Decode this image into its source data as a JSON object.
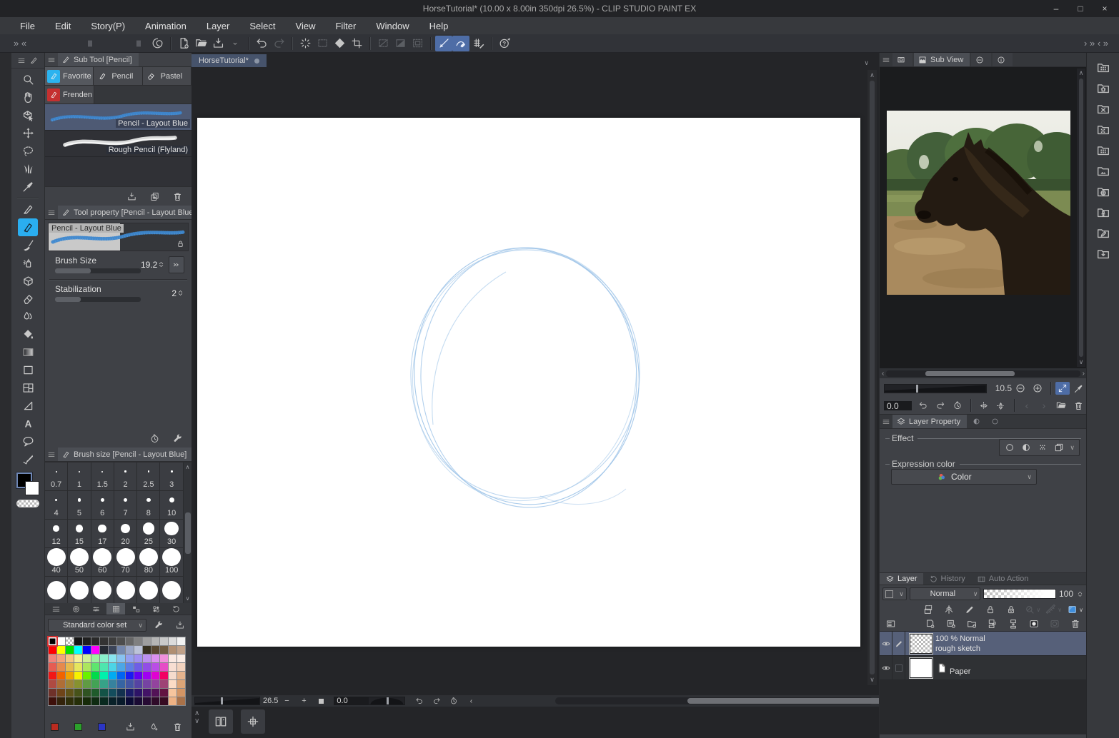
{
  "window": {
    "title": "HorseTutorial* (10.00 x 8.00in 350dpi 26.5%)  - CLIP STUDIO PAINT EX",
    "minimize": "–",
    "maximize": "□",
    "close": "×"
  },
  "menubar": [
    "File",
    "Edit",
    "Story(P)",
    "Animation",
    "Layer",
    "Select",
    "View",
    "Filter",
    "Window",
    "Help"
  ],
  "command_bar": {
    "left_collapse": "» «",
    "right_collapse": "› » ‹ »",
    "groups": [
      [
        {
          "icon": "clip-studio-logo",
          "name": "clip-studio-home"
        }
      ],
      [
        {
          "icon": "new-document",
          "name": "new-document"
        },
        {
          "icon": "open-file",
          "name": "open-file"
        },
        {
          "icon": "save-file",
          "name": "save-file"
        },
        {
          "icon": "chevron-down",
          "name": "save-options",
          "small": true
        }
      ],
      [
        {
          "icon": "undo",
          "name": "undo"
        },
        {
          "icon": "redo",
          "name": "redo",
          "disabled": true
        }
      ],
      [
        {
          "icon": "clear",
          "name": "clear"
        },
        {
          "icon": "marquee-dashed",
          "name": "clear-outside-selection",
          "disabled": true
        },
        {
          "icon": "fill-diamond",
          "name": "fill"
        },
        {
          "icon": "trim",
          "name": "trim"
        }
      ],
      [
        {
          "icon": "transform1",
          "name": "deselect",
          "disabled": true
        },
        {
          "icon": "transform2",
          "name": "invert-selection",
          "disabled": true
        },
        {
          "icon": "transform3",
          "name": "border-selection",
          "disabled": true
        }
      ],
      [
        {
          "icon": "snap-ruler",
          "name": "snap-to-ruler",
          "active": true
        },
        {
          "icon": "snap-special",
          "name": "snap-to-special-ruler",
          "active": true
        },
        {
          "icon": "snap-grid",
          "name": "snap-to-grid"
        }
      ],
      [
        {
          "icon": "how-to-use",
          "name": "how-to-use"
        }
      ]
    ]
  },
  "tool_palette": {
    "tools": [
      {
        "name": "zoom",
        "icon": "magnifier"
      },
      {
        "name": "move",
        "icon": "hand"
      },
      {
        "name": "operation",
        "icon": "object-cursor"
      },
      {
        "name": "layer-move",
        "icon": "move-arrows"
      },
      {
        "name": "selection",
        "icon": "lasso"
      },
      {
        "name": "auto-select",
        "icon": "grass"
      },
      {
        "name": "eyedropper",
        "icon": "eyedropper"
      },
      {
        "name": "pen",
        "icon": "pen-nib",
        "group_start": true
      },
      {
        "name": "pencil",
        "icon": "pencil-tool",
        "selected": true
      },
      {
        "name": "brush",
        "icon": "brush-tool"
      },
      {
        "name": "airbrush",
        "icon": "airbrush"
      },
      {
        "name": "decoration",
        "icon": "decoration"
      },
      {
        "name": "eraser",
        "icon": "eraser"
      },
      {
        "name": "blend",
        "icon": "blend"
      },
      {
        "name": "fill",
        "icon": "paint-bucket"
      },
      {
        "name": "gradient",
        "icon": "gradient"
      },
      {
        "name": "frame-border",
        "icon": "frame-rect"
      },
      {
        "name": "divide-frame",
        "icon": "frame-divided"
      },
      {
        "name": "figure",
        "icon": "figure-shape"
      },
      {
        "name": "text",
        "icon": "text-a"
      },
      {
        "name": "balloon",
        "icon": "balloon"
      },
      {
        "name": "correct-line",
        "icon": "correct-line"
      }
    ],
    "main_color": "#000000",
    "sub_color": "#ffffff"
  },
  "sub_tool_panel": {
    "title": "Sub Tool [Pencil]",
    "tabs": [
      {
        "label": "Favorite",
        "selected": true,
        "icon_bg": "#2bb3ef"
      },
      {
        "label": "Pencil",
        "icon_bg": ""
      },
      {
        "label": "Pastel",
        "icon_bg": ""
      },
      {
        "label": "Frenden",
        "icon_bg": "#c53030"
      }
    ],
    "brushes": [
      {
        "name": "Pencil - Layout Blue",
        "selected": true,
        "stroke": "blue"
      },
      {
        "name": "Rough Pencil (Flyland)",
        "stroke": "white"
      }
    ],
    "footer_icons": [
      {
        "icon": "import-down",
        "name": "import-sub-tool"
      },
      {
        "icon": "duplicate",
        "name": "copy-sub-tool"
      },
      {
        "icon": "trash",
        "name": "delete-sub-tool"
      }
    ]
  },
  "tool_property_panel": {
    "title": "Tool property [Pencil - Layout Blue]",
    "preview_label": "Pencil - Layout Blue",
    "params": [
      {
        "label": "Brush Size",
        "value": "19.2",
        "fill": 0.42,
        "indicator": true
      },
      {
        "label": "Stabilization",
        "value": "2",
        "fill": 0.3,
        "indicator": false
      }
    ],
    "footer_icons": [
      {
        "icon": "clock",
        "name": "restore-initial-settings"
      },
      {
        "icon": "wrench",
        "name": "sub-tool-detail"
      }
    ]
  },
  "brush_size_panel": {
    "title": "Brush size [Pencil - Layout Blue]",
    "sizes": [
      "0.7",
      "1",
      "1.5",
      "2",
      "2.5",
      "3",
      "4",
      "5",
      "6",
      "7",
      "8",
      "10",
      "12",
      "15",
      "17",
      "20",
      "25",
      "30",
      "40",
      "50",
      "60",
      "70",
      "80",
      "100"
    ],
    "overflow_count": 6
  },
  "color_set_panel": {
    "tabs": [
      {
        "icon": "menu",
        "name": "color-panel-menu"
      },
      {
        "icon": "color-wheel",
        "name": "tab-color-wheel"
      },
      {
        "icon": "color-slider",
        "name": "tab-color-slider"
      },
      {
        "icon": "color-set",
        "name": "tab-color-set",
        "selected": true
      },
      {
        "icon": "intermediate",
        "name": "tab-intermediate-color"
      },
      {
        "icon": "approximate",
        "name": "tab-approximate-color"
      },
      {
        "icon": "history-tab",
        "name": "tab-color-history"
      }
    ],
    "set_name": "Standard color set",
    "header_icons": [
      {
        "icon": "wrench",
        "name": "edit-color-set"
      },
      {
        "icon": "import-down",
        "name": "import-color-set"
      }
    ],
    "rows": [
      [
        "#000000",
        "#ffffff",
        "checker",
        "#161616",
        "#1f1f1f",
        "#292929",
        "#333333",
        "#3d3d3d",
        "#4d4d4d",
        "#666666",
        "#808080",
        "#9e9e9e",
        "#b5b5b5",
        "#c9c9c9",
        "#dcdcdc",
        "#f2f2f2"
      ],
      [
        "#ff0000",
        "#ffff00",
        "#00e100",
        "#00ffff",
        "#0000ff",
        "#ff00ff",
        "#252a33",
        "#3b4458",
        "#7487ad",
        "#9aa6c6",
        "#bcc3d8",
        "#36301f",
        "#574731",
        "#6f5b42",
        "#b18f72",
        "#c0a189"
      ],
      [
        "#f0837b",
        "#f2a47c",
        "#f4c983",
        "#f4f096",
        "#d0f096",
        "#9cf0a0",
        "#88f0cc",
        "#88e4f0",
        "#88c2f0",
        "#94a0f0",
        "#a090f0",
        "#bc90f0",
        "#da90f0",
        "#f090da",
        "#fbe9e1",
        "#fbece4"
      ],
      [
        "#e65c52",
        "#e68a4d",
        "#e6ba4d",
        "#e6e65e",
        "#ace65e",
        "#5ee66e",
        "#4de6ae",
        "#4dd4e6",
        "#4da6e6",
        "#5e7ee6",
        "#6e5ee6",
        "#924de6",
        "#ba4de6",
        "#e64dc6",
        "#f8ded2",
        "#f3d3bf"
      ],
      [
        "#f21616",
        "#f26300",
        "#f2a300",
        "#f7f200",
        "#6af200",
        "#00dc4a",
        "#00f2ac",
        "#00acf2",
        "#0063f2",
        "#1a1af2",
        "#6300f2",
        "#a000f2",
        "#e200d2",
        "#f20063",
        "#f5dbcd",
        "#e6b48e"
      ],
      [
        "#af4a42",
        "#af6e36",
        "#9e8636",
        "#87922f",
        "#609b43",
        "#43a355",
        "#36a388",
        "#36829e",
        "#3664a3",
        "#4355a3",
        "#5543a3",
        "#7643a3",
        "#93439e",
        "#9e4375",
        "#fcdcc5",
        "#dca577"
      ],
      [
        "#6f3129",
        "#6f4419",
        "#5f5319",
        "#475319",
        "#2f5321",
        "#1f5b2b",
        "#135347",
        "#134d5d",
        "#13314f",
        "#1b1b67",
        "#2d1367",
        "#431367",
        "#531357",
        "#631341",
        "#f7c59d",
        "#d49564"
      ],
      [
        "#3e100a",
        "#34230b",
        "#2f2f0b",
        "#262f09",
        "#172b09",
        "#0f2b11",
        "#09291f",
        "#092129",
        "#091b2b",
        "#0b0b34",
        "#1a0b34",
        "#270b34",
        "#2f0b29",
        "#370b21",
        "#efb284",
        "#aa7249"
      ]
    ],
    "selected_cell": {
      "row": 0,
      "col": 0
    },
    "footer_swatches": [
      "#bb2b20",
      "#2ba02b",
      "#2b35c4"
    ],
    "footer_icons": [
      {
        "icon": "import-down",
        "name": "register-color"
      },
      {
        "icon": "droplet-add",
        "name": "add-color"
      },
      {
        "icon": "trash",
        "name": "delete-color"
      }
    ]
  },
  "document": {
    "tab_label": "HorseTutorial*",
    "zoom_value": "26.5",
    "rotation_value": "0.0",
    "sketch_color": "#9fc4e8"
  },
  "bottom_bar": {
    "buttons": [
      {
        "icon": "spread-view",
        "name": "page-spread-view"
      },
      {
        "icon": "register-marks",
        "name": "register-marks-view"
      }
    ]
  },
  "sub_view_panel": {
    "tabs": [
      {
        "icon": "navigator-tab",
        "name": "tab-navigator",
        "label": ""
      },
      {
        "icon": "subview-tab",
        "name": "tab-sub-view",
        "label": "Sub View",
        "selected": true
      },
      {
        "icon": "itembank-tab",
        "name": "tab-item-bank",
        "label": ""
      },
      {
        "icon": "info-tab",
        "name": "tab-information",
        "label": ""
      }
    ],
    "zoom_value": "10.5",
    "rotation_value": "0.0"
  },
  "layer_property_panel": {
    "title": "Layer Property",
    "effect_label": "Effect",
    "effect_icons": [
      {
        "icon": "border-effect",
        "name": "border-effect"
      },
      {
        "icon": "tone-effect",
        "name": "tone-effect"
      },
      {
        "icon": "halftone-effect",
        "name": "layer-reflect-effect"
      },
      {
        "icon": "extract-line",
        "name": "extract-line-effect"
      }
    ],
    "expression_label": "Expression color",
    "expression_value": "Color"
  },
  "layer_panel": {
    "tabs": [
      {
        "icon": "layers-tab",
        "label": "Layer",
        "name": "tab-layer",
        "selected": true
      },
      {
        "icon": "history-tab",
        "label": "History",
        "name": "tab-history"
      },
      {
        "icon": "autoaction-tab",
        "label": "Auto Action",
        "name": "tab-auto-action"
      }
    ],
    "blend_mode": "Normal",
    "opacity": "100",
    "mode_icons": [
      {
        "icon": "clipping",
        "name": "clip-to-layer-below"
      },
      {
        "icon": "draft",
        "name": "draft-layer"
      },
      {
        "icon": "pencil-edit",
        "name": "lock-draw"
      },
      {
        "icon": "lock",
        "name": "lock-layer"
      },
      {
        "icon": "lock-checker",
        "name": "lock-transparent-pixels"
      },
      {
        "icon": "ref-layer",
        "name": "reference-layer",
        "disabled": true,
        "chevron": true
      },
      {
        "icon": "ruler-icon",
        "name": "enable-ruler",
        "disabled": true,
        "chevron": true
      },
      {
        "icon": "layer-color-chip",
        "name": "layer-color",
        "chevron": true
      }
    ],
    "action_icons_left": [
      {
        "icon": "panel-list",
        "name": "layer-palette-options"
      }
    ],
    "action_icons_right": [
      {
        "icon": "new-layer",
        "name": "new-raster-layer"
      },
      {
        "icon": "new-layer2",
        "name": "new-layer-dialog"
      },
      {
        "icon": "new-folder",
        "name": "new-layer-folder"
      },
      {
        "icon": "transfer-down",
        "name": "transfer-to-lower-layer"
      },
      {
        "icon": "merge-down",
        "name": "merge-with-lower-layer"
      },
      {
        "icon": "mask",
        "name": "create-layer-mask"
      },
      {
        "icon": "mask-apply",
        "name": "apply-mask",
        "disabled": true
      },
      {
        "icon": "trash",
        "name": "delete-layer"
      }
    ],
    "layers": [
      {
        "info": "100 % Normal",
        "name": "rough sketch",
        "selected": true,
        "thumb": "checker",
        "editing": true,
        "visible": true
      },
      {
        "info": "",
        "name": "Paper",
        "selected": false,
        "thumb": "white",
        "paper_icon": true,
        "visible": true
      }
    ]
  },
  "material_dock": {
    "items": [
      {
        "icon": "folder-grid",
        "name": "material-folder-all"
      },
      {
        "icon": "folder-home",
        "name": "material-folder-color-pattern"
      },
      {
        "icon": "folder-x",
        "name": "material-folder-monochromatic"
      },
      {
        "icon": "folder-pattern",
        "name": "material-folder-manga"
      },
      {
        "icon": "folder-grid",
        "name": "material-folder-image"
      },
      {
        "icon": "folder-image",
        "name": "material-folder-illustration"
      },
      {
        "icon": "folder-globe",
        "name": "material-folder-web"
      },
      {
        "icon": "folder-figure",
        "name": "material-folder-3d"
      },
      {
        "icon": "folder-edit",
        "name": "material-folder-create"
      },
      {
        "icon": "folder-download",
        "name": "material-folder-download"
      }
    ]
  }
}
